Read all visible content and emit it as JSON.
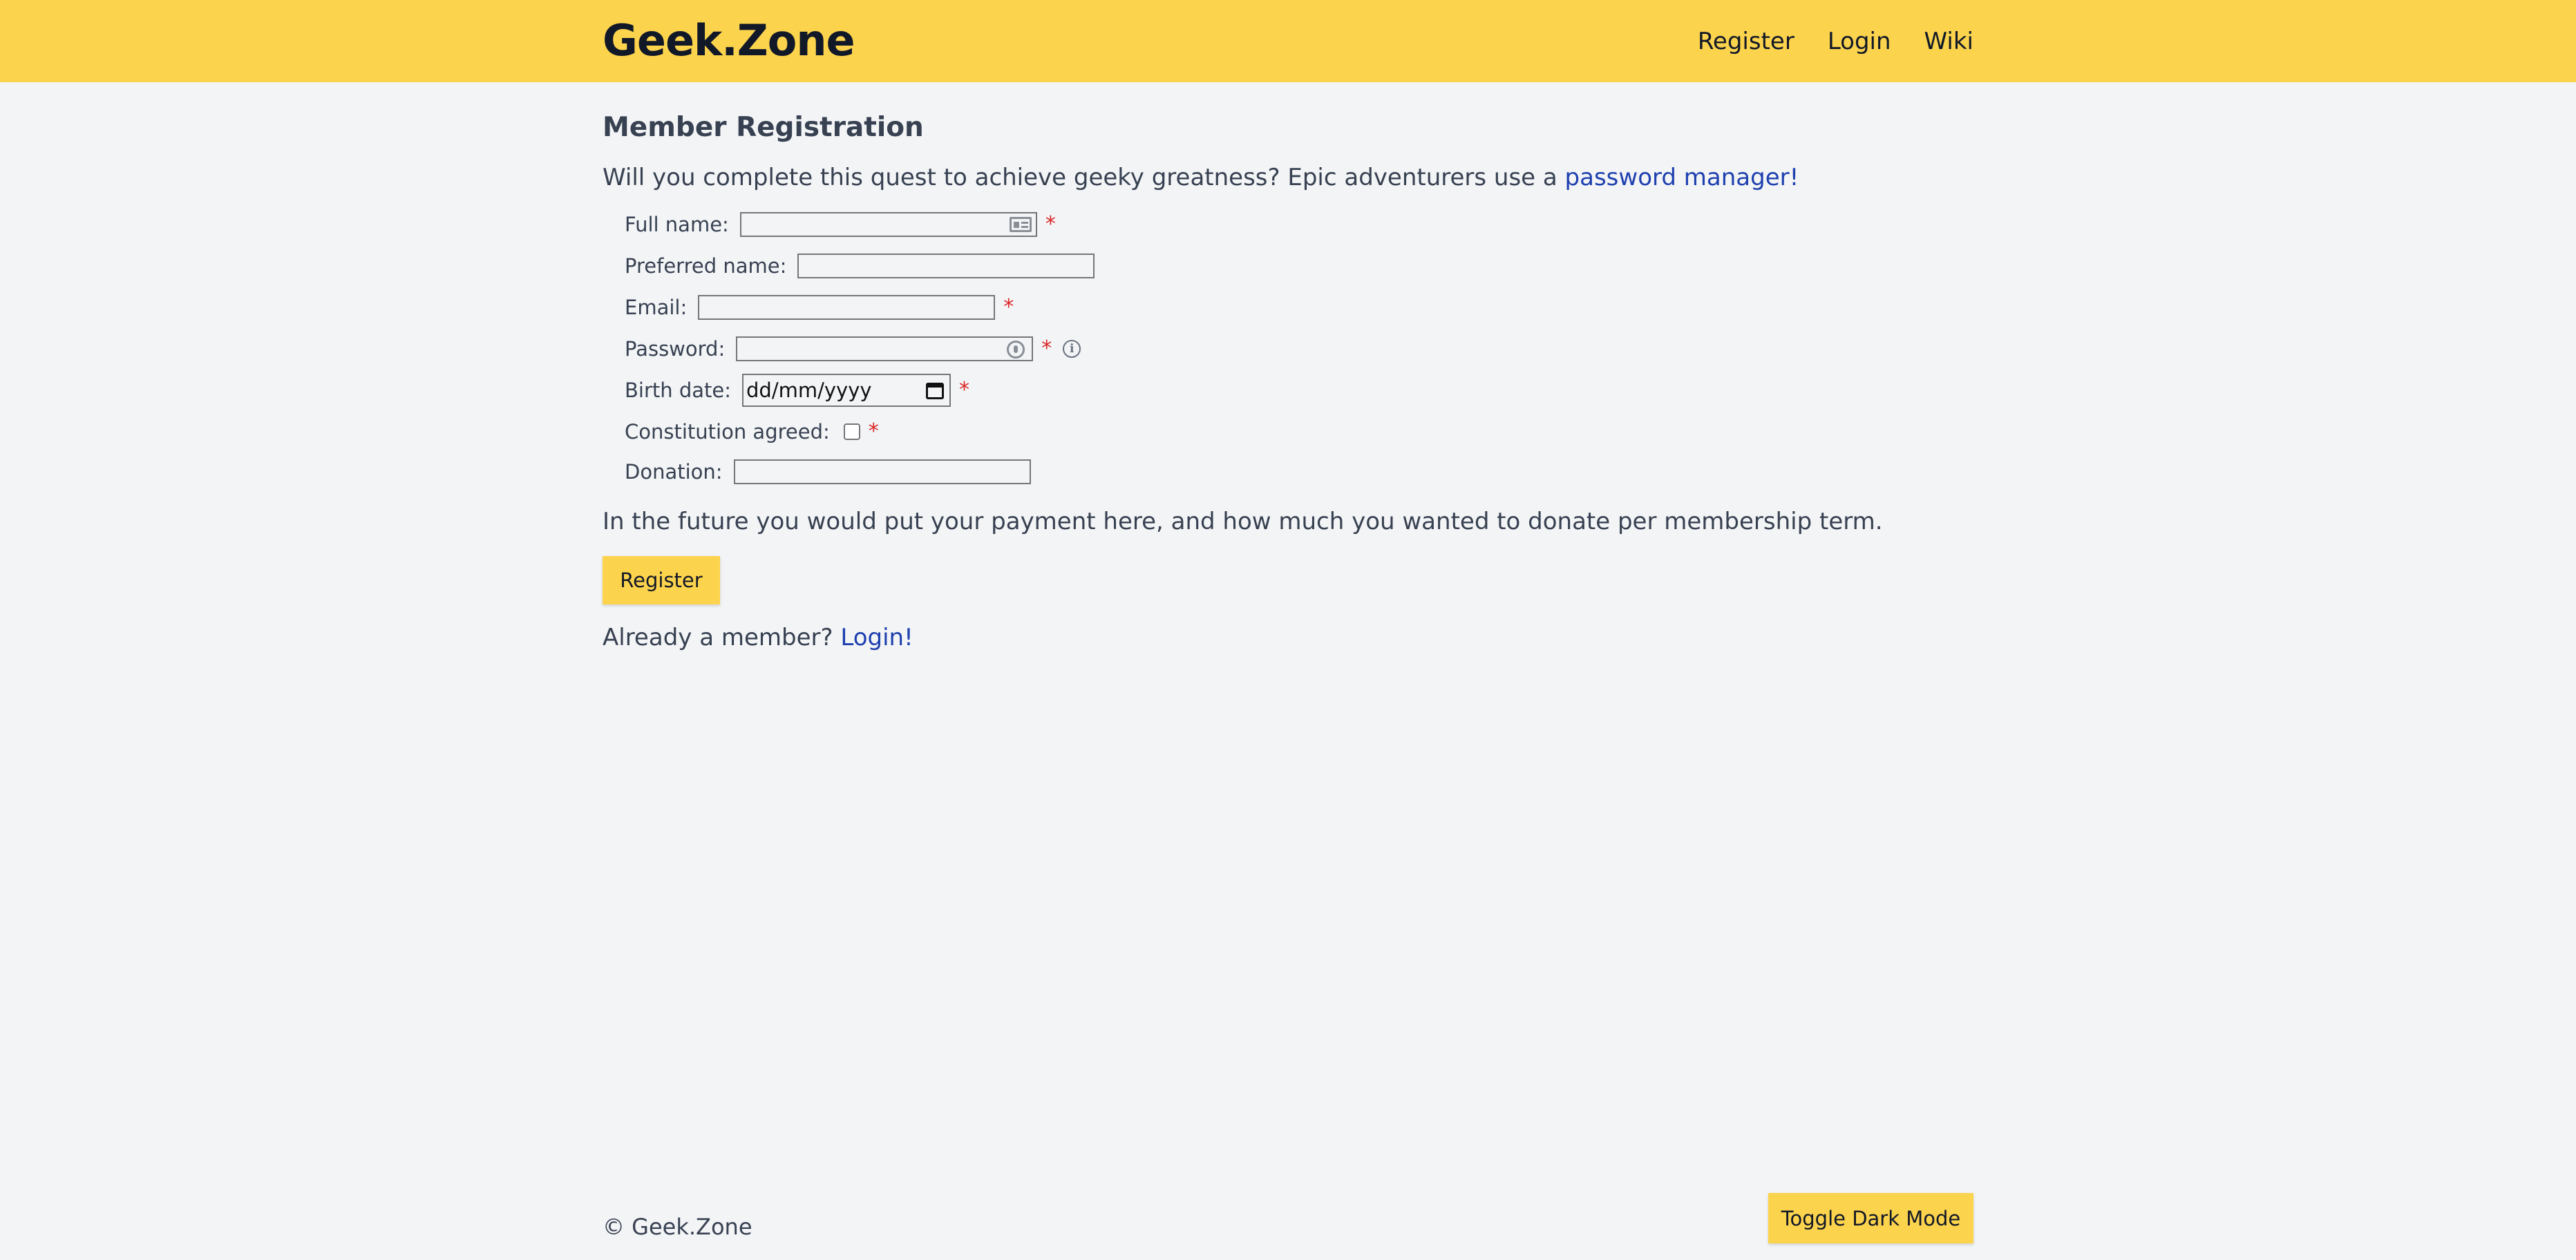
{
  "header": {
    "brand": "Geek.Zone",
    "nav": [
      "Register",
      "Login",
      "Wiki"
    ]
  },
  "page": {
    "title": "Member Registration",
    "intro_text": "Will you complete this quest to achieve geeky greatness? Epic adventurers use a ",
    "intro_link": "password manager!"
  },
  "form": {
    "full_name_label": "Full name:",
    "preferred_name_label": "Preferred name:",
    "email_label": "Email:",
    "password_label": "Password:",
    "birth_date_label": "Birth date:",
    "birth_date_placeholder": "dd/mm/yyyy",
    "constitution_label": "Constitution agreed:",
    "donation_label": "Donation:",
    "required_mark": "*",
    "info_glyph": "i",
    "note": "In the future you would put your payment here, and how much you wanted to donate per membership term.",
    "submit_label": "Register",
    "already_text": "Already a member? ",
    "login_link": "Login!"
  },
  "footer": {
    "copyright": "© Geek.Zone",
    "toggle_label": "Toggle Dark Mode"
  },
  "colors": {
    "accent": "#fcd34d",
    "link": "#1e40af",
    "required": "#dc2626",
    "background": "#f3f4f6"
  },
  "icons": [
    "contact-card-icon",
    "password-key-icon",
    "info-icon",
    "calendar-icon"
  ]
}
